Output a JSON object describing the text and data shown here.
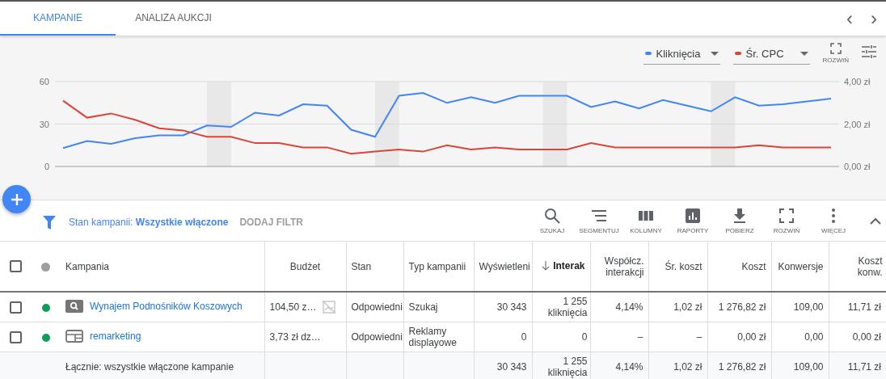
{
  "tabs": [
    {
      "label": "KAMPANIE",
      "selected": true
    },
    {
      "label": "ANALIZA AUKCJI",
      "selected": false
    }
  ],
  "nav": [
    "‹",
    "›"
  ],
  "chart": {
    "expand_label": "ROZWIŃ",
    "chart_data": {
      "type": "line",
      "ylim": [
        0,
        60
      ],
      "yticks": [
        0,
        30,
        60
      ],
      "y2lim": [
        0,
        4
      ],
      "y2ticks": [
        {
          "value": 0,
          "label": "0,00 zł"
        },
        {
          "value": 2,
          "label": "2,00 zł"
        },
        {
          "value": 4,
          "label": "4,00 zł"
        }
      ],
      "series": [
        {
          "name": "Kliknięcia",
          "color": "#4285f4",
          "values": [
            13,
            18,
            16,
            20,
            22,
            22,
            29,
            28,
            38,
            36,
            44,
            43,
            26,
            21,
            50,
            52,
            45,
            49,
            45,
            50,
            50,
            50,
            42,
            46,
            41,
            47,
            43,
            39,
            49,
            43,
            44,
            46,
            48
          ]
        },
        {
          "name": "Śr. CPC",
          "color": "#db4437",
          "axis": "y2",
          "values": [
            3.1,
            2.3,
            2.5,
            2.2,
            1.8,
            1.7,
            1.4,
            1.4,
            1.1,
            1.1,
            0.9,
            0.9,
            0.6,
            0.7,
            0.8,
            0.7,
            1,
            0.8,
            0.9,
            0.8,
            0.8,
            0.8,
            1.1,
            0.9,
            0.9,
            0.9,
            0.9,
            0.9,
            0.9,
            1,
            0.9,
            0.9,
            0.9
          ]
        }
      ]
    }
  },
  "filter": {
    "text": "Stan kampanii: **Wszystkie włączone**",
    "add": "DODAJ FILTR"
  },
  "toolbar": [
    {
      "kind": "search",
      "label": "SZUKAJ"
    },
    {
      "kind": "segment",
      "label": "SEGMENTUJ"
    },
    {
      "kind": "columns",
      "label": "KOLUMNY"
    },
    {
      "kind": "reports",
      "label": "RAPORTY"
    },
    {
      "kind": "download",
      "label": "POBIERZ"
    },
    {
      "kind": "expand",
      "label": "ROZWIŃ"
    },
    {
      "kind": "more",
      "label": "WIĘCEJ"
    }
  ],
  "table": {
    "header_checked": false,
    "columns": [
      {
        "label": "Kampania",
        "sorted": false
      },
      {
        "label": "Budżet",
        "sorted": false
      },
      {
        "label": "Stan",
        "sorted": false
      },
      {
        "label": "Typ kampanii",
        "sorted": false
      },
      {
        "label": "Wyświetleni",
        "sorted": false
      },
      {
        "label": "Interak",
        "sorted": true
      },
      {
        "label": "Współcz. interakcji",
        "sorted": false
      },
      {
        "label": "Śr. koszt",
        "sorted": false
      },
      {
        "label": "Koszt",
        "sorted": false
      },
      {
        "label": "Konwersje",
        "sorted": false
      },
      {
        "label": "Koszt konw.",
        "sorted": false
      }
    ],
    "rows": [
      {
        "checked": false,
        "color": "#0f9d58",
        "kind": "search",
        "budget_icon": true,
        "cells": [
          "Wynajem Podnośników Koszowych",
          "104,50 z…",
          "Odpowiedni",
          "Szukaj",
          "30 343",
          "1 255 kliknięcia",
          "4,14%",
          "1,02 zł",
          "1 276,82 zł",
          "109,00",
          "11,71 zł"
        ]
      },
      {
        "checked": false,
        "color": "#0f9d58",
        "kind": "display",
        "budget_icon": false,
        "cells": [
          "remarketing",
          "3,73 zł dz…",
          "Odpowiedni",
          "Reklamy displayowe",
          "0",
          "0",
          "–",
          "–",
          "0,00 zł",
          "0,00",
          "0,00 zł"
        ]
      }
    ],
    "total": {
      "cells": [
        "Łącznie: wszystkie włączone kampanie",
        "",
        "",
        "",
        "30 343",
        "1 255 kliknięcia",
        "4,14%",
        "1,02 zł",
        "1 276,82 zł",
        "109,00",
        "11,71 zł"
      ]
    }
  }
}
